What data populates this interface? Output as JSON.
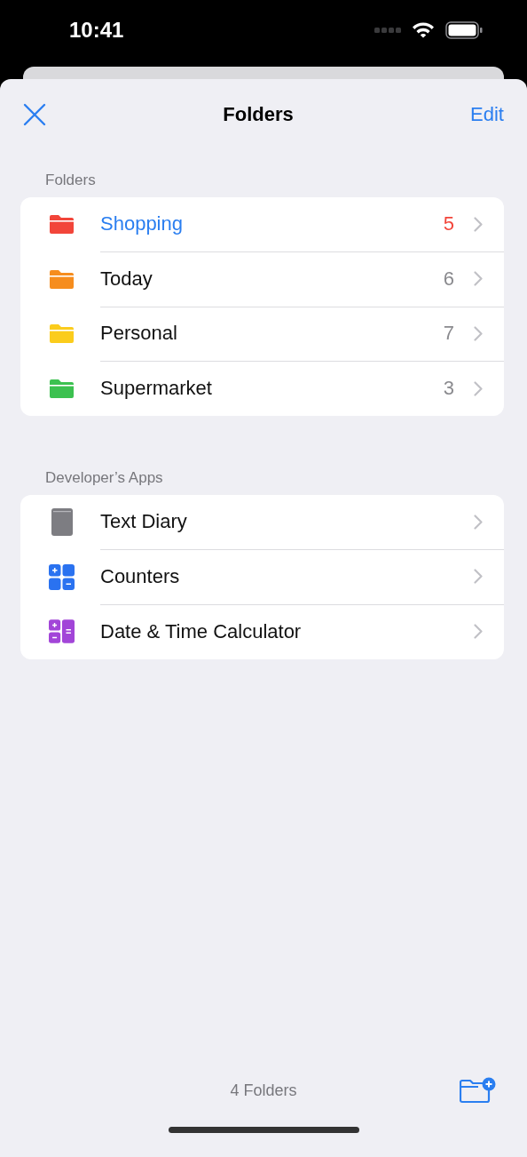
{
  "status_bar": {
    "time": "10:41"
  },
  "nav": {
    "title": "Folders",
    "action": "Edit"
  },
  "folders_section": {
    "header": "Folders",
    "items": [
      {
        "name": "Shopping",
        "count": "5",
        "color": "#f2453a",
        "selected": true
      },
      {
        "name": "Today",
        "count": "6",
        "color": "#f68d1e",
        "selected": false
      },
      {
        "name": "Personal",
        "count": "7",
        "color": "#fbcc1c",
        "selected": false
      },
      {
        "name": "Supermarket",
        "count": "3",
        "color": "#3cc150",
        "selected": false
      }
    ]
  },
  "apps_section": {
    "header": "Developer’s Apps",
    "items": [
      {
        "name": "Text Diary",
        "kind": "book",
        "color": "#7d7d82"
      },
      {
        "name": "Counters",
        "kind": "counter",
        "color": "#2a72f0"
      },
      {
        "name": "Date & Time Calculator",
        "kind": "calculator",
        "color": "#a245d8"
      }
    ]
  },
  "toolbar": {
    "summary": "4 Folders"
  }
}
